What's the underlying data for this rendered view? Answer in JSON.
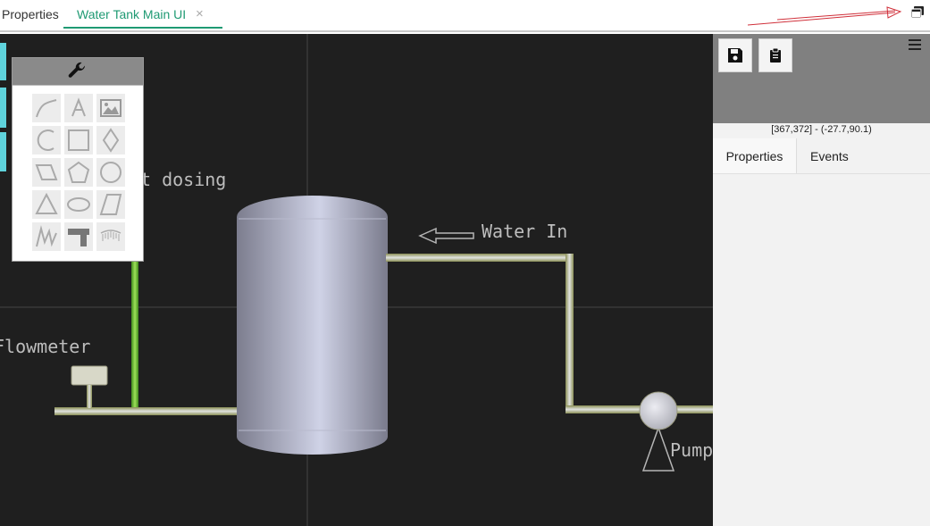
{
  "tabs": {
    "properties_label": "Properties",
    "active_label": "Water Tank Main UI",
    "close_symbol": "×"
  },
  "icons": {
    "restore": "restore-windows-icon",
    "arrow": "red-arrow-icon",
    "wrench": "wrench-icon",
    "save": "save-icon",
    "clipboard": "clipboard-icon",
    "menu": "hamburger-menu-icon"
  },
  "scene": {
    "label_dosing": "t dosing",
    "label_water_in": "Water In",
    "label_flowmeter": "Flowmeter",
    "label_pump": "Pump"
  },
  "tools": {
    "items": [
      "curve",
      "text",
      "image",
      "arc",
      "rectangle",
      "diamond",
      "parallelogram",
      "pentagon",
      "circle",
      "triangle",
      "ellipse",
      "trapezoid",
      "zigzag",
      "pipe",
      "gauge"
    ]
  },
  "panel": {
    "coords": "[367,372] - (-27.7,90.1)",
    "tab_properties": "Properties",
    "tab_events": "Events"
  },
  "colors": {
    "accent": "#1f9a73",
    "cyan": "#5fd3dc",
    "canvas_bg": "#1f1f1f",
    "pipe_green": "#6ec33a"
  }
}
